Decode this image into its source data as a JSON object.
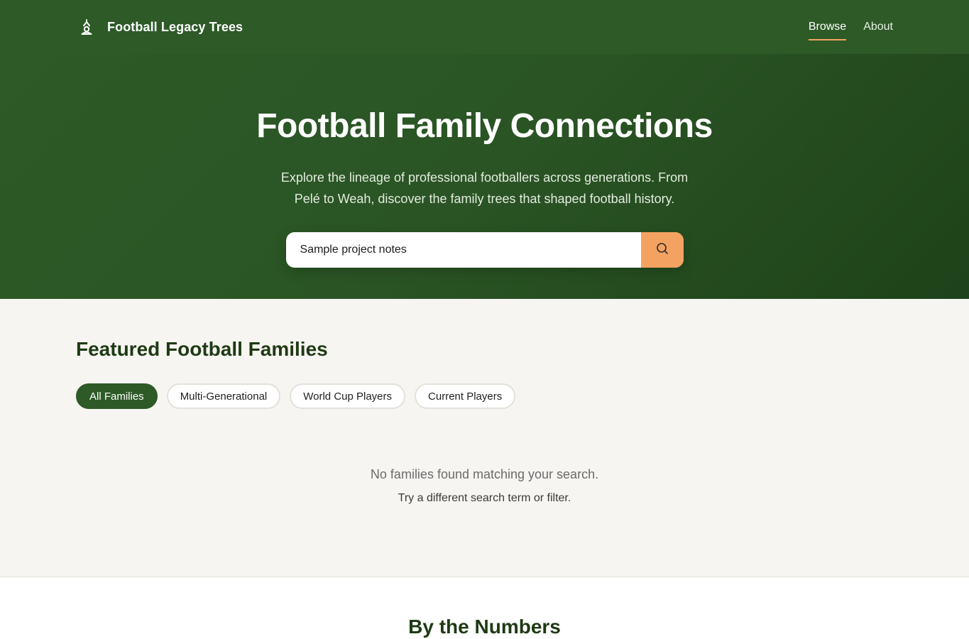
{
  "header": {
    "brand_name": "Football Legacy Trees",
    "brand_icon": "family-tree-icon",
    "nav": [
      {
        "label": "Browse",
        "active": true
      },
      {
        "label": "About",
        "active": false
      }
    ]
  },
  "hero": {
    "title": "Football Family Connections",
    "subtitle": "Explore the lineage of professional footballers across generations. From Pelé to Weah, discover the family trees that shaped football history.",
    "search": {
      "value": "Sample project notes",
      "button_icon": "search-icon"
    }
  },
  "featured": {
    "title": "Featured Football Families",
    "filters": [
      {
        "label": "All Families",
        "active": true
      },
      {
        "label": "Multi-Generational",
        "active": false
      },
      {
        "label": "World Cup Players",
        "active": false
      },
      {
        "label": "Current Players",
        "active": false
      }
    ],
    "empty_message": "No families found matching your search.",
    "empty_hint": "Try a different search term or filter."
  },
  "numbers": {
    "title": "By the Numbers"
  },
  "colors": {
    "primary_green": "#2d5a27",
    "accent_orange": "#f4a261",
    "page_background": "#f7f5f1"
  }
}
